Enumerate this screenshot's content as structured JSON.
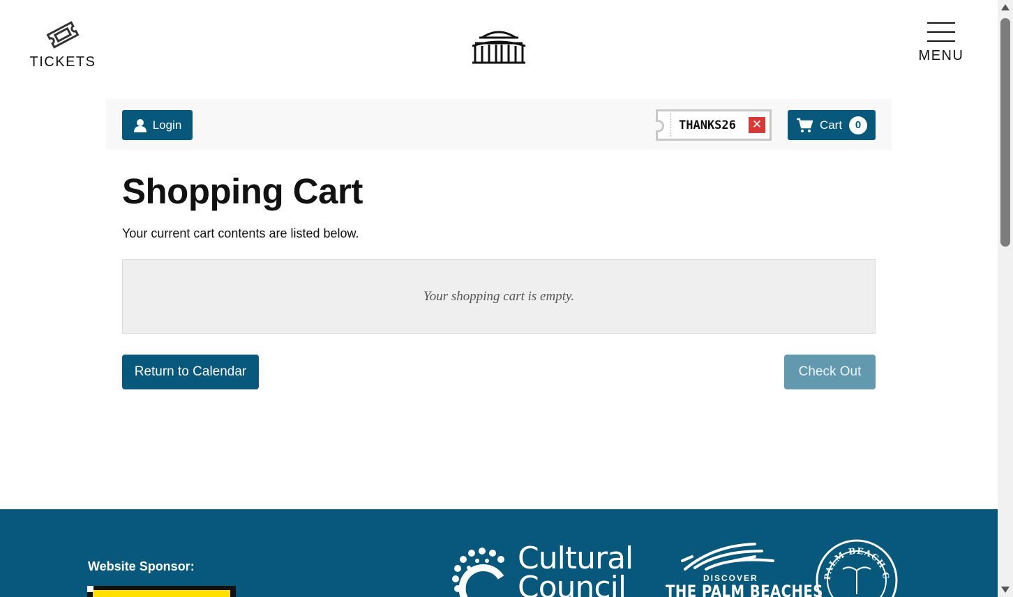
{
  "header": {
    "tickets_label": "TICKETS",
    "menu_label": "MENU",
    "logo_icon": "pavilion-logo-icon"
  },
  "toolbar": {
    "login_label": "Login",
    "promo_code": "THANKS26",
    "promo_remove_glyph": "✕",
    "cart_label": "Cart",
    "cart_count": "0"
  },
  "main": {
    "title": "Shopping Cart",
    "intro": "Your current cart contents are listed below.",
    "empty_message": "Your shopping cart is empty.",
    "return_label": "Return to Calendar",
    "checkout_label": "Check Out"
  },
  "footer": {
    "sponsor_label": "Website Sponsor:",
    "cultural_council_text": "Cultural Council",
    "discover_text": "DISCOVER",
    "palm_beaches_text": "THE PALM BEACHES",
    "seal_text": "PALM BEACH COUNTY"
  },
  "colors": {
    "primary": "#07587a",
    "checkout_disabled": "#6299ae",
    "promo_remove": "#d63a36",
    "footer_bg": "#07587a"
  }
}
